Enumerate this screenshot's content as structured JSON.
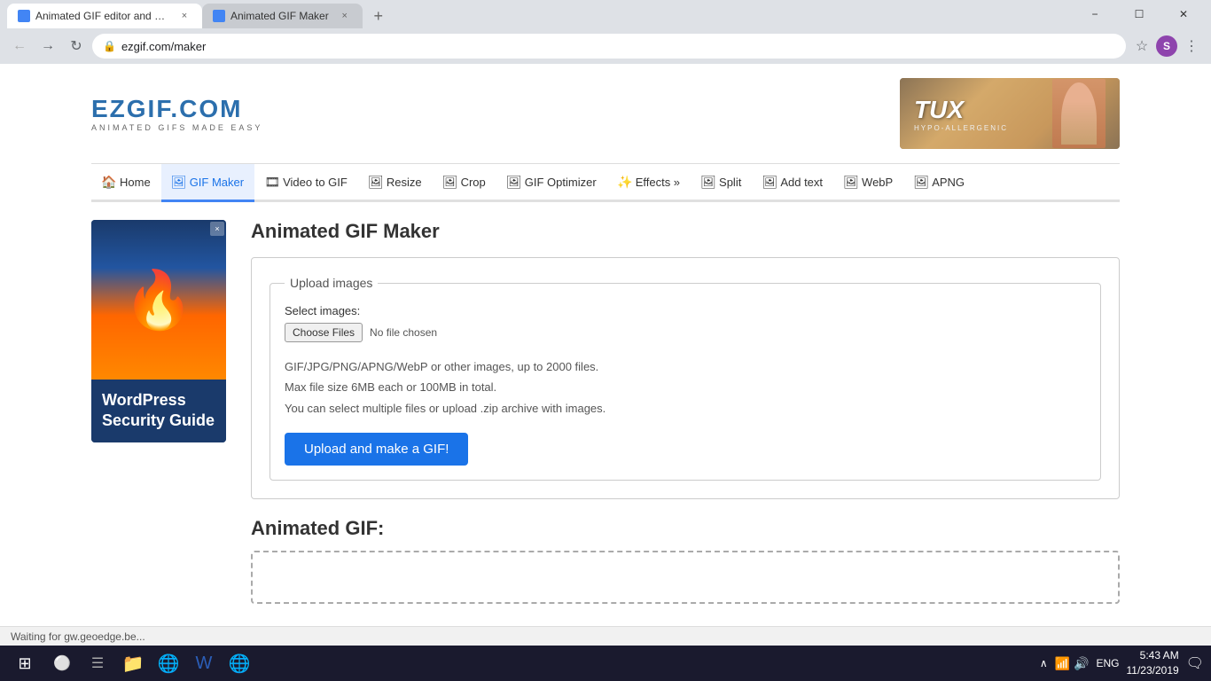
{
  "browser": {
    "tabs": [
      {
        "id": "tab1",
        "title": "Animated GIF editor and GIF ma...",
        "active": true,
        "favicon": "gif"
      },
      {
        "id": "tab2",
        "title": "Animated GIF Maker",
        "active": false,
        "favicon": "gif"
      }
    ],
    "url": "ezgif.com/maker",
    "window_controls": [
      "minimize",
      "maximize",
      "close"
    ]
  },
  "nav": {
    "back": "‹",
    "forward": "›",
    "refresh": "↻",
    "url": "ezgif.com/maker"
  },
  "site": {
    "logo": {
      "main": "EZGIF.COM",
      "sub": "Animated Gifs Made Easy"
    },
    "ad_brand": "TUX",
    "nav_items": [
      {
        "id": "home",
        "label": "Home",
        "icon": "🏠",
        "active": false
      },
      {
        "id": "gif-maker",
        "label": "GIF Maker",
        "icon": "🖼",
        "active": true
      },
      {
        "id": "video-to-gif",
        "label": "Video to GIF",
        "icon": "🎞",
        "active": false
      },
      {
        "id": "resize",
        "label": "Resize",
        "icon": "🖼",
        "active": false
      },
      {
        "id": "crop",
        "label": "Crop",
        "icon": "🖼",
        "active": false
      },
      {
        "id": "gif-optimizer",
        "label": "GIF Optimizer",
        "icon": "🖼",
        "active": false
      },
      {
        "id": "effects",
        "label": "Effects »",
        "icon": "✨",
        "active": false
      },
      {
        "id": "split",
        "label": "Split",
        "icon": "🖼",
        "active": false
      },
      {
        "id": "add-text",
        "label": "Add text",
        "icon": "🖼",
        "active": false
      },
      {
        "id": "webp",
        "label": "WebP",
        "icon": "🖼",
        "active": false
      },
      {
        "id": "apng",
        "label": "APNG",
        "icon": "🖼",
        "active": false
      }
    ],
    "sidebar_ad": {
      "title": "WordPress Security Guide",
      "close": "×"
    },
    "page_title": "Animated GIF Maker",
    "upload": {
      "legend": "Upload images",
      "select_label": "Select images:",
      "choose_button": "Choose Files",
      "no_file": "No file chosen",
      "hint1": "GIF/JPG/PNG/APNG/WebP or other images, up to 2000 files.",
      "hint2": "Max file size 6MB each or 100MB in total.",
      "hint3": "You can select multiple files or upload .zip archive with images.",
      "upload_button": "Upload and make a GIF!"
    },
    "gif_section": {
      "title": "Animated GIF:"
    }
  },
  "status_bar": {
    "text": "Waiting for gw.geoedge.be..."
  },
  "taskbar": {
    "time": "5:43 AM",
    "date": "11/23/2019",
    "language": "ENG",
    "icons": [
      "🔔"
    ]
  }
}
